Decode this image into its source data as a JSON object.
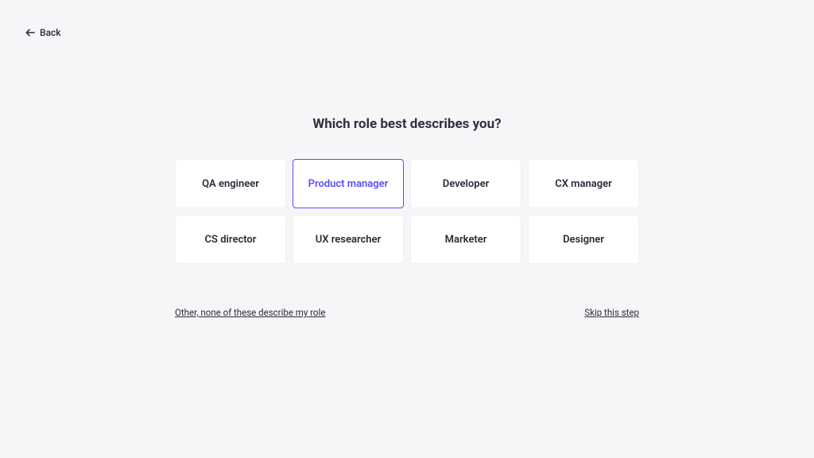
{
  "back_label": "Back",
  "heading": "Which role best describes you?",
  "roles": [
    {
      "id": "qa-engineer",
      "label": "QA engineer",
      "selected": false
    },
    {
      "id": "product-manager",
      "label": "Product manager",
      "selected": true
    },
    {
      "id": "developer",
      "label": "Developer",
      "selected": false
    },
    {
      "id": "cx-manager",
      "label": "CX manager",
      "selected": false
    },
    {
      "id": "cs-director",
      "label": "CS director",
      "selected": false
    },
    {
      "id": "ux-researcher",
      "label": "UX researcher",
      "selected": false
    },
    {
      "id": "marketer",
      "label": "Marketer",
      "selected": false
    },
    {
      "id": "designer",
      "label": "Designer",
      "selected": false
    }
  ],
  "other_link": "Other, none of these describe my role",
  "skip_link": "Skip this step",
  "colors": {
    "accent": "#5b4cff",
    "page_bg": "#f6f6f8",
    "card_bg": "#ffffff",
    "text": "#2b2b3a"
  }
}
